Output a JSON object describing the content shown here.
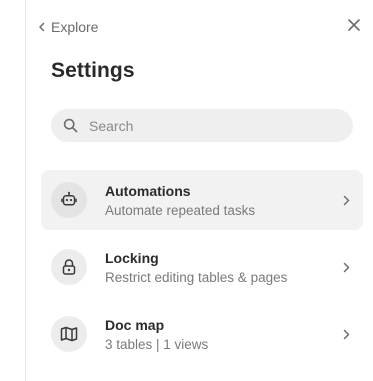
{
  "header": {
    "back_label": "Explore",
    "back_icon": "chevron-left-icon",
    "close_icon": "close-icon"
  },
  "page": {
    "title": "Settings"
  },
  "search": {
    "placeholder": "Search",
    "value": "",
    "icon": "search-icon"
  },
  "items": [
    {
      "title": "Automations",
      "description": "Automate repeated tasks",
      "icon": "robot-icon",
      "active": true
    },
    {
      "title": "Locking",
      "description": "Restrict editing tables & pages",
      "icon": "lock-icon",
      "active": false
    },
    {
      "title": "Doc map",
      "description": "3 tables | 1 views",
      "icon": "map-icon",
      "active": false
    }
  ],
  "colors": {
    "text_primary": "#2b2b2b",
    "text_secondary": "#7a7a7a",
    "search_bg": "#efefef",
    "active_row_bg": "#f2f2f2",
    "icon_circle_bg": "#ececec"
  }
}
